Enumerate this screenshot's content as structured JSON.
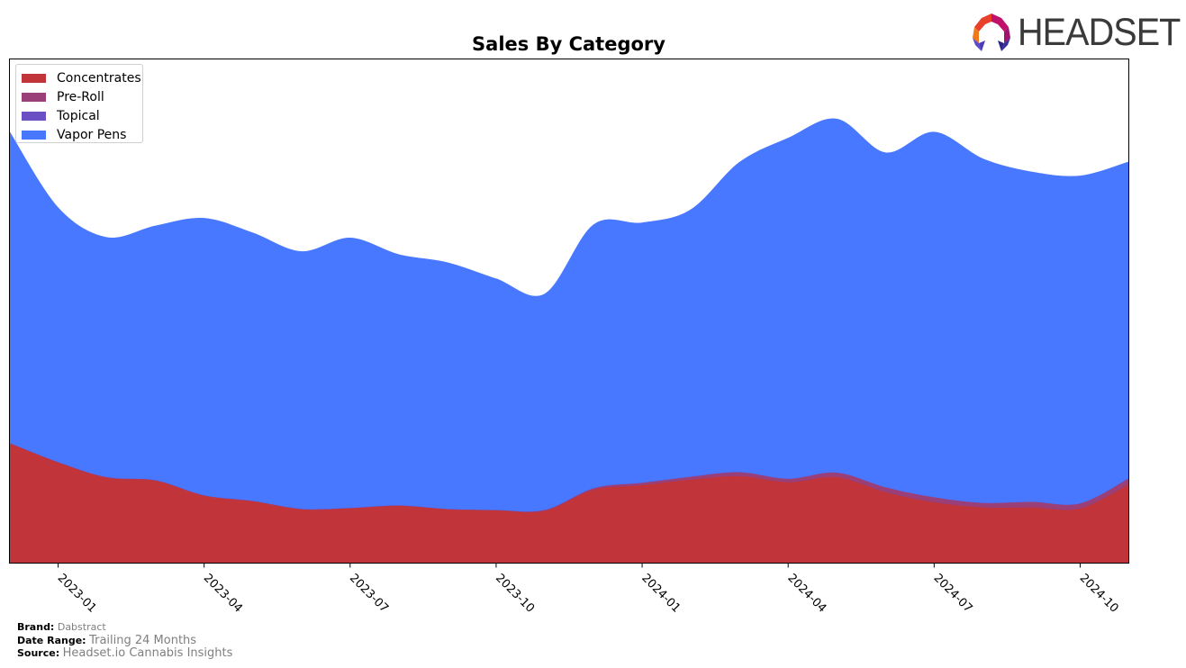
{
  "logo": {
    "text": "HEADSET",
    "icon": "headset-logo-icon"
  },
  "footer": {
    "brand_label": "Brand:",
    "brand_value": "Dabstract",
    "date_range_label": "Date Range:",
    "date_range_value": "Trailing 24 Months",
    "source_label": "Source:",
    "source_value": "Headset.io Cannabis Insights"
  },
  "chart_data": {
    "type": "area",
    "stacked": true,
    "title": "Sales By Category",
    "xlabel": "",
    "ylabel": "",
    "y_units": "relative (no y-axis ticks shown)",
    "ylim": [
      0,
      100
    ],
    "grid": false,
    "legend_position": "top-left",
    "x": [
      "2022-12",
      "2023-01",
      "2023-02",
      "2023-03",
      "2023-04",
      "2023-05",
      "2023-06",
      "2023-07",
      "2023-08",
      "2023-09",
      "2023-10",
      "2023-11",
      "2023-12",
      "2024-01",
      "2024-02",
      "2024-03",
      "2024-04",
      "2024-05",
      "2024-06",
      "2024-07",
      "2024-08",
      "2024-09",
      "2024-10",
      "2024-11"
    ],
    "x_tick_labels": [
      "2023-01",
      "2023-04",
      "2023-07",
      "2023-10",
      "2024-01",
      "2024-04",
      "2024-07",
      "2024-10"
    ],
    "series": [
      {
        "name": "Concentrates",
        "color": "#c0343a",
        "values": [
          23.8,
          20.0,
          17.0,
          16.4,
          13.4,
          12.3,
          10.7,
          10.9,
          11.4,
          10.7,
          10.5,
          10.4,
          14.6,
          15.5,
          16.6,
          17.3,
          16.1,
          17.1,
          14.1,
          12.1,
          11.1,
          11.1,
          10.9,
          15.7
        ]
      },
      {
        "name": "Pre-Roll",
        "color": "#9a3f78",
        "values": [
          0.1,
          0.1,
          0.1,
          0.1,
          0.1,
          0.1,
          0.1,
          0.1,
          0.1,
          0.1,
          0.1,
          0.2,
          0.3,
          0.5,
          0.6,
          0.8,
          0.7,
          0.9,
          1.0,
          1.0,
          0.9,
          1.1,
          1.0,
          1.2
        ]
      },
      {
        "name": "Topical",
        "color": "#6b4fc4",
        "values": [
          0,
          0,
          0,
          0,
          0,
          0,
          0,
          0,
          0,
          0,
          0,
          0,
          0,
          0,
          0,
          0,
          0,
          0,
          0,
          0,
          0,
          0,
          0,
          0
        ]
      },
      {
        "name": "Vapor Pens",
        "color": "#4878ff",
        "values": [
          61.7,
          50.4,
          47.5,
          50.4,
          54.9,
          53.1,
          51.0,
          53.5,
          49.7,
          48.8,
          45.8,
          42.8,
          52.2,
          51.5,
          52.9,
          61.4,
          67.5,
          70.1,
          66.3,
          72.4,
          68.2,
          65.4,
          64.9,
          62.7
        ]
      }
    ]
  }
}
